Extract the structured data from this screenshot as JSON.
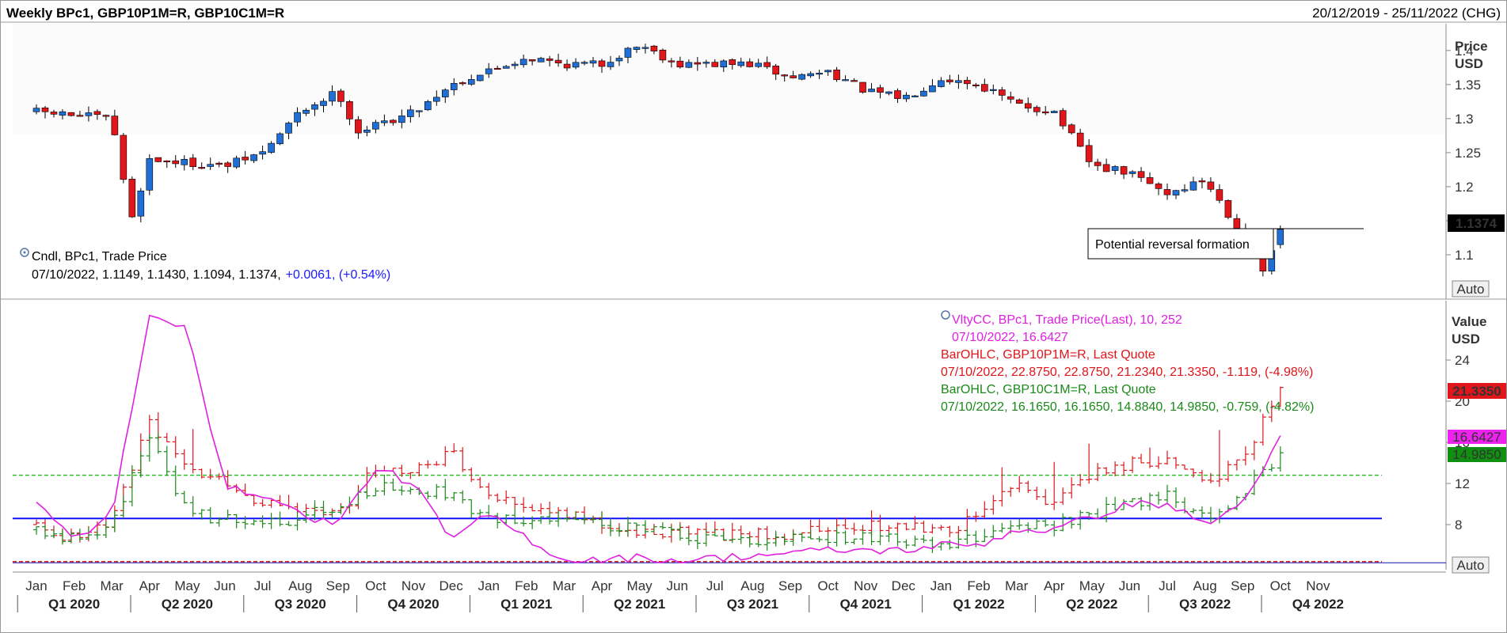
{
  "header": {
    "title": "Weekly BPc1, GBP10P1M=R, GBP10C1M=R",
    "date_range": "20/12/2019 - 25/11/2022 (CHG)"
  },
  "top_panel": {
    "axis_title": "Price",
    "axis_unit": "USD",
    "auto_label": "Auto",
    "last_price_label": "1.1374",
    "callout": "Potential reversal formation",
    "legend_icon": "target-icon",
    "legend_line1": "Cndl, BPc1, Trade Price",
    "legend_line2_values": "07/10/2022, 1.1149, 1.1430, 1.1094, 1.1374,",
    "legend_line2_change": "+0.0061, (+0.54%)"
  },
  "bottom_panel": {
    "axis_title": "Value",
    "axis_unit": "USD",
    "auto_label": "Auto",
    "tag_put": "21.3350",
    "tag_vol": "16.6427",
    "tag_call": "14.9850",
    "legend_vol_line1": "VltyCC, BPc1, Trade Price(Last),  10, 252",
    "legend_vol_line2": "07/10/2022, 16.6427",
    "legend_put_line1": "BarOHLC, GBP10P1M=R, Last Quote",
    "legend_put_line2": "07/10/2022, 22.8750, 22.8750, 21.2340, 21.3350, -1.119, (-4.98%)",
    "legend_call_line1": "BarOHLC, GBP10C1M=R, Last Quote",
    "legend_call_line2": "07/10/2022, 16.1650, 16.1650, 14.8840, 14.9850, -0.759, (-4.82%)"
  },
  "x_axis": {
    "months": [
      "Jan",
      "Feb",
      "Mar",
      "Apr",
      "May",
      "Jun",
      "Jul",
      "Aug",
      "Sep",
      "Oct",
      "Nov",
      "Dec",
      "Jan",
      "Feb",
      "Mar",
      "Apr",
      "May",
      "Jun",
      "Jul",
      "Aug",
      "Sep",
      "Oct",
      "Nov",
      "Dec",
      "Jan",
      "Feb",
      "Mar",
      "Apr",
      "May",
      "Jun",
      "Jul",
      "Aug",
      "Sep",
      "Oct",
      "Nov"
    ],
    "quarters": [
      "Q1 2020",
      "Q2 2020",
      "Q3 2020",
      "Q4 2020",
      "Q1 2021",
      "Q2 2021",
      "Q3 2021",
      "Q4 2021",
      "Q1 2022",
      "Q2 2022",
      "Q3 2022",
      "Q4 2022"
    ]
  },
  "colors": {
    "up": "#1f6fd6",
    "down": "#e0161b",
    "volatility": "#e020e0",
    "put": "#e0161b",
    "call": "#1a8a1a",
    "hline_blue": "#1010ff",
    "hline_green": "#22bb22",
    "hline_red": "#cc0000",
    "change_text": "#1a1aff"
  },
  "chart_data": [
    {
      "type": "candlestick",
      "series_name": "BPc1",
      "frequency": "weekly",
      "y_axis_ticks": [
        1.1,
        1.15,
        1.2,
        1.25,
        1.3,
        1.35,
        1.4
      ],
      "ylim": [
        1.05,
        1.43
      ],
      "last_close": 1.1374,
      "last_bar": {
        "date": "07/10/2022",
        "open": 1.1149,
        "high": 1.143,
        "low": 1.1094,
        "close": 1.1374
      },
      "close_path": [
        {
          "month": "Jan 2020",
          "value": 1.31
        },
        {
          "month": "Mar 2020",
          "value": 1.3
        },
        {
          "month": "Mar 2020 (low)",
          "value": 1.15
        },
        {
          "month": "Apr 2020",
          "value": 1.24
        },
        {
          "month": "Jun 2020",
          "value": 1.23
        },
        {
          "month": "Jul 2020",
          "value": 1.25
        },
        {
          "month": "Aug 2020",
          "value": 1.31
        },
        {
          "month": "Sep 2020",
          "value": 1.34
        },
        {
          "month": "Sep 2020 (dip)",
          "value": 1.28
        },
        {
          "month": "Oct 2020",
          "value": 1.29
        },
        {
          "month": "Nov 2020",
          "value": 1.31
        },
        {
          "month": "Dec 2020",
          "value": 1.35
        },
        {
          "month": "Jan 2021",
          "value": 1.37
        },
        {
          "month": "Feb 2021",
          "value": 1.39
        },
        {
          "month": "Mar 2021",
          "value": 1.38
        },
        {
          "month": "Apr 2021",
          "value": 1.38
        },
        {
          "month": "May 2021",
          "value": 1.41
        },
        {
          "month": "Jun 2021",
          "value": 1.38
        },
        {
          "month": "Jul 2021",
          "value": 1.38
        },
        {
          "month": "Aug 2021",
          "value": 1.38
        },
        {
          "month": "Sep 2021",
          "value": 1.36
        },
        {
          "month": "Oct 2021",
          "value": 1.37
        },
        {
          "month": "Nov 2021",
          "value": 1.34
        },
        {
          "month": "Dec 2021",
          "value": 1.33
        },
        {
          "month": "Jan 2022",
          "value": 1.36
        },
        {
          "month": "Feb 2022",
          "value": 1.35
        },
        {
          "month": "Mar 2022",
          "value": 1.32
        },
        {
          "month": "Apr 2022",
          "value": 1.31
        },
        {
          "month": "May 2022",
          "value": 1.23
        },
        {
          "month": "Jun 2022",
          "value": 1.22
        },
        {
          "month": "Jul 2022",
          "value": 1.19
        },
        {
          "month": "Aug 2022",
          "value": 1.21
        },
        {
          "month": "Sep 2022",
          "value": 1.13
        },
        {
          "month": "Sep 2022 (low)",
          "value": 1.07
        },
        {
          "month": "Oct 2022",
          "value": 1.1374
        }
      ]
    },
    {
      "type": "line+bar",
      "y_axis_ticks": [
        8,
        12,
        16,
        20,
        24
      ],
      "ylim": [
        4,
        29
      ],
      "horizontal_lines": [
        {
          "color": "blue",
          "value": 8.6
        },
        {
          "color": "green-dashed",
          "value": 12.8
        },
        {
          "color": "red-dashed",
          "value": 4.4
        }
      ],
      "series": [
        {
          "name": "VltyCC, BPc1, Trade Price(Last),  10, 252",
          "last": 16.6427,
          "path": [
            {
              "month": "Jan 2020",
              "value": 10
            },
            {
              "month": "Feb 2020",
              "value": 6.5
            },
            {
              "month": "Mar 2020",
              "value": 9
            },
            {
              "month": "Apr 2020",
              "value": 28
            },
            {
              "month": "May 2020",
              "value": 27.5
            },
            {
              "month": "Jun 2020",
              "value": 11.5
            },
            {
              "month": "Jul 2020",
              "value": 11
            },
            {
              "month": "Aug 2020",
              "value": 9
            },
            {
              "month": "Sep 2020",
              "value": 8
            },
            {
              "month": "Oct 2020",
              "value": 13.5
            },
            {
              "month": "Nov 2020",
              "value": 12
            },
            {
              "month": "Dec 2020",
              "value": 6.5
            },
            {
              "month": "Jan 2021",
              "value": 9
            },
            {
              "month": "Mar 2021",
              "value": 4.5
            },
            {
              "month": "May 2021",
              "value": 4.8
            },
            {
              "month": "Jun 2021",
              "value": 4.5
            },
            {
              "month": "Aug 2021",
              "value": 5
            },
            {
              "month": "Oct 2021",
              "value": 5.5
            },
            {
              "month": "Dec 2021",
              "value": 5.5
            },
            {
              "month": "Jan 2022",
              "value": 6
            },
            {
              "month": "Feb 2022",
              "value": 6
            },
            {
              "month": "Mar 2022",
              "value": 7.5
            },
            {
              "month": "Apr 2022",
              "value": 7.5
            },
            {
              "month": "Jun 2022",
              "value": 10
            },
            {
              "month": "Jul 2022",
              "value": 10
            },
            {
              "month": "Aug 2022",
              "value": 8
            },
            {
              "month": "Sep 2022",
              "value": 10
            },
            {
              "month": "Oct 2022",
              "value": 16.6427
            }
          ]
        },
        {
          "name": "BarOHLC, GBP10P1M=R, Last Quote",
          "last": 21.335,
          "path": [
            {
              "month": "Jan 2020",
              "value": 8
            },
            {
              "month": "Feb 2020",
              "value": 6.5
            },
            {
              "month": "Mar 2020",
              "value": 8
            },
            {
              "month": "Apr 2020",
              "value": 18
            },
            {
              "month": "May 2020",
              "value": 13
            },
            {
              "month": "Jun 2020",
              "value": 12
            },
            {
              "month": "Jul 2020",
              "value": 10
            },
            {
              "month": "Aug 2020",
              "value": 9
            },
            {
              "month": "Sep 2020",
              "value": 9
            },
            {
              "month": "Oct 2020",
              "value": 13.5
            },
            {
              "month": "Nov 2020",
              "value": 13
            },
            {
              "month": "Dec 2020",
              "value": 15
            },
            {
              "month": "Jan 2021",
              "value": 11
            },
            {
              "month": "Feb 2021",
              "value": 9
            },
            {
              "month": "Mar 2021",
              "value": 9
            },
            {
              "month": "May 2021",
              "value": 7.5
            },
            {
              "month": "Jul 2021",
              "value": 7
            },
            {
              "month": "Sep 2021",
              "value": 7
            },
            {
              "month": "Nov 2021",
              "value": 8
            },
            {
              "month": "Jan 2022",
              "value": 7.5
            },
            {
              "month": "Feb 2022",
              "value": 8.5
            },
            {
              "month": "Mar 2022",
              "value": 12
            },
            {
              "month": "Apr 2022",
              "value": 10
            },
            {
              "month": "May 2022",
              "value": 13
            },
            {
              "month": "Jun 2022",
              "value": 14
            },
            {
              "month": "Jul 2022",
              "value": 14
            },
            {
              "month": "Aug 2022",
              "value": 12
            },
            {
              "month": "Sep 2022",
              "value": 14
            },
            {
              "month": "Oct 2022",
              "value": 21.335
            }
          ]
        },
        {
          "name": "BarOHLC, GBP10C1M=R, Last Quote",
          "last": 14.985,
          "path": [
            {
              "month": "Jan 2020",
              "value": 7.5
            },
            {
              "month": "Feb 2020",
              "value": 6.5
            },
            {
              "month": "Mar 2020",
              "value": 8
            },
            {
              "month": "Apr 2020",
              "value": 17
            },
            {
              "month": "May 2020",
              "value": 9
            },
            {
              "month": "Jun 2020",
              "value": 8.5
            },
            {
              "month": "Jul 2020",
              "value": 8.5
            },
            {
              "month": "Aug 2020",
              "value": 8.5
            },
            {
              "month": "Sep 2020",
              "value": 10
            },
            {
              "month": "Oct 2020",
              "value": 11.5
            },
            {
              "month": "Nov 2020",
              "value": 11.5
            },
            {
              "month": "Dec 2020",
              "value": 11
            },
            {
              "month": "Jan 2021",
              "value": 8.5
            },
            {
              "month": "Mar 2021",
              "value": 8.5
            },
            {
              "month": "May 2021",
              "value": 7.5
            },
            {
              "month": "Jul 2021",
              "value": 6.5
            },
            {
              "month": "Sep 2021",
              "value": 6.5
            },
            {
              "month": "Nov 2021",
              "value": 7
            },
            {
              "month": "Jan 2022",
              "value": 6
            },
            {
              "month": "Feb 2022",
              "value": 7
            },
            {
              "month": "Mar 2022",
              "value": 8
            },
            {
              "month": "Apr 2022",
              "value": 8
            },
            {
              "month": "May 2022",
              "value": 9
            },
            {
              "month": "Jun 2022",
              "value": 10
            },
            {
              "month": "Jul 2022",
              "value": 11
            },
            {
              "month": "Aug 2022",
              "value": 8.5
            },
            {
              "month": "Sep 2022",
              "value": 11
            },
            {
              "month": "Oct 2022",
              "value": 14.985
            }
          ]
        }
      ]
    }
  ]
}
